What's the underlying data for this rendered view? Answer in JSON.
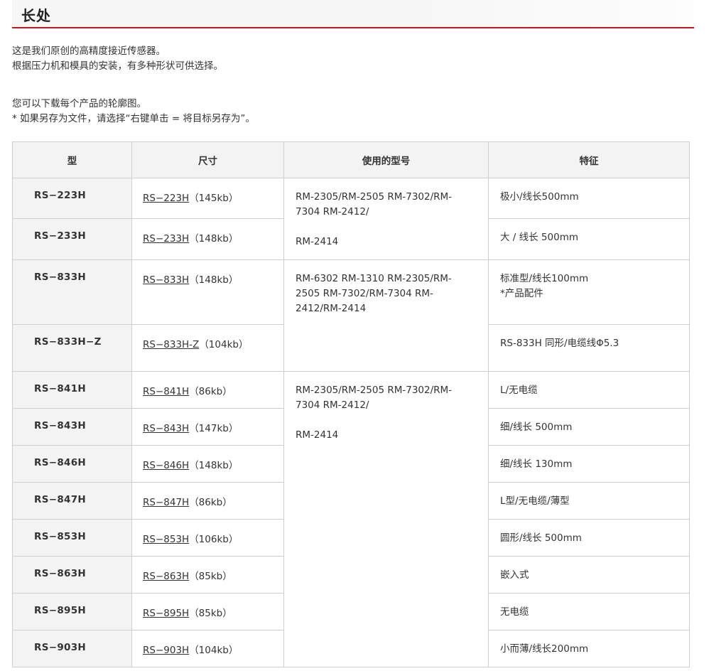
{
  "header": {
    "title": "长处"
  },
  "intro": {
    "lines": [
      "这是我们原创的高精度接近传感器。",
      "根据压力机和模具的安装，有多种形状可供选择。",
      "您可以下载每个产品的轮廓图。",
      "* 如果另存为文件，请选择“右键单击 = 将目标另存为”。"
    ]
  },
  "table": {
    "headers": [
      "型",
      "尺寸",
      "使用的型号",
      "特征"
    ],
    "groups": [
      {
        "line1": "RM-2305/RM-2505 RM-7302/RM-",
        "line2": "7304 RM-2412/",
        "line3": "RM-2414"
      },
      {
        "line1": "RM-6302 RM-1310 RM-2305/RM-",
        "line2": "2505 RM-7302/RM-7304 RM-",
        "line3": "2412/RM-2414"
      },
      {
        "line1": "RM-2305/RM-2505 RM-7302/RM-",
        "line2": "7304 RM-2412/",
        "line3": "RM-2414"
      }
    ],
    "rows": [
      {
        "model": "RS−223H",
        "link": "RS−223H",
        "size": "（145kb）",
        "feature": "极小/线长500mm"
      },
      {
        "model": "RS−233H",
        "link": "RS−233H",
        "size": "（148kb）",
        "feature": "大 / 线长 500mm"
      },
      {
        "model": "RS−833H",
        "link": "RS−833H",
        "size": "（148kb）",
        "feature": "标准型/线长100mm",
        "feature2": "*产品配件"
      },
      {
        "model": "RS−833H−Z",
        "link": "RS−833H-Z",
        "size": "（104kb）",
        "feature": "RS-833H 同形/电缆线Φ5.3"
      },
      {
        "model": "RS−841H",
        "link": "RS−841H",
        "size": "（86kb）",
        "feature": "L/无电缆"
      },
      {
        "model": "RS−843H",
        "link": "RS−843H",
        "size": "（147kb）",
        "feature": "细/线长 500mm"
      },
      {
        "model": "RS−846H",
        "link": "RS−846H",
        "size": "（148kb）",
        "feature": "细/线长 130mm"
      },
      {
        "model": "RS−847H",
        "link": "RS−847H",
        "size": "（86kb）",
        "feature": "L型/无电缆/薄型"
      },
      {
        "model": "RS−853H",
        "link": "RS−853H",
        "size": "（106kb）",
        "feature": "圆形/线长 500mm"
      },
      {
        "model": "RS−863H",
        "link": "RS−863H",
        "size": "（85kb）",
        "feature": "嵌入式"
      },
      {
        "model": "RS−895H",
        "link": "RS−895H",
        "size": "（85kb）",
        "feature": "无电缆"
      },
      {
        "model": "RS−903H",
        "link": "RS−903H",
        "size": "（104kb）",
        "feature": "小而薄/线长200mm"
      }
    ]
  },
  "colors": {
    "accent": "#c8161d",
    "header_bg": "#f3f3f3",
    "border": "#cfcfcf"
  }
}
